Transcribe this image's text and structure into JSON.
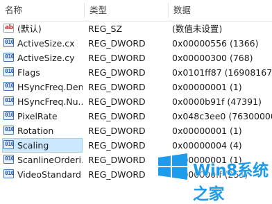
{
  "columns": {
    "name": "名称",
    "type": "类型",
    "data": "数据"
  },
  "rows": [
    {
      "icon": "string-value-icon",
      "name": "(默认)",
      "type": "REG_SZ",
      "data": "(数值未设置)"
    },
    {
      "icon": "binary-value-icon",
      "name": "ActiveSize.cx",
      "type": "REG_DWORD",
      "data": "0x00000556 (1366)"
    },
    {
      "icon": "binary-value-icon",
      "name": "ActiveSize.cy",
      "type": "REG_DWORD",
      "data": "0x00000300 (768)"
    },
    {
      "icon": "binary-value-icon",
      "name": "Flags",
      "type": "REG_DWORD",
      "data": "0x0101ff87 (16908167)"
    },
    {
      "icon": "binary-value-icon",
      "name": "HSyncFreq.Den...",
      "type": "REG_DWORD",
      "data": "0x00000001 (1)"
    },
    {
      "icon": "binary-value-icon",
      "name": "HSyncFreq.Nu...",
      "type": "REG_DWORD",
      "data": "0x0000b91f (47391)"
    },
    {
      "icon": "binary-value-icon",
      "name": "PixelRate",
      "type": "REG_DWORD",
      "data": "0x048c3ee0 (76300000)"
    },
    {
      "icon": "binary-value-icon",
      "name": "Rotation",
      "type": "REG_DWORD",
      "data": "0x00000001 (1)"
    },
    {
      "icon": "binary-value-icon",
      "name": "Scaling",
      "type": "REG_DWORD",
      "data": "0x00000004 (4)",
      "selected": true
    },
    {
      "icon": "binary-value-icon",
      "name": "ScanlineOrderi...",
      "type": "REG_DWORD",
      "data": "0x00000001 (1)"
    },
    {
      "icon": "binary-value-icon",
      "name": "VideoStandard",
      "type": "REG_DWORD",
      "data": "0x000000ff (255)"
    }
  ],
  "watermark": {
    "text": "Win8系统之家",
    "color": "#1e9bea"
  },
  "colors": {
    "selection_background": "#cce8ff",
    "selection_border": "#99d1ff"
  }
}
